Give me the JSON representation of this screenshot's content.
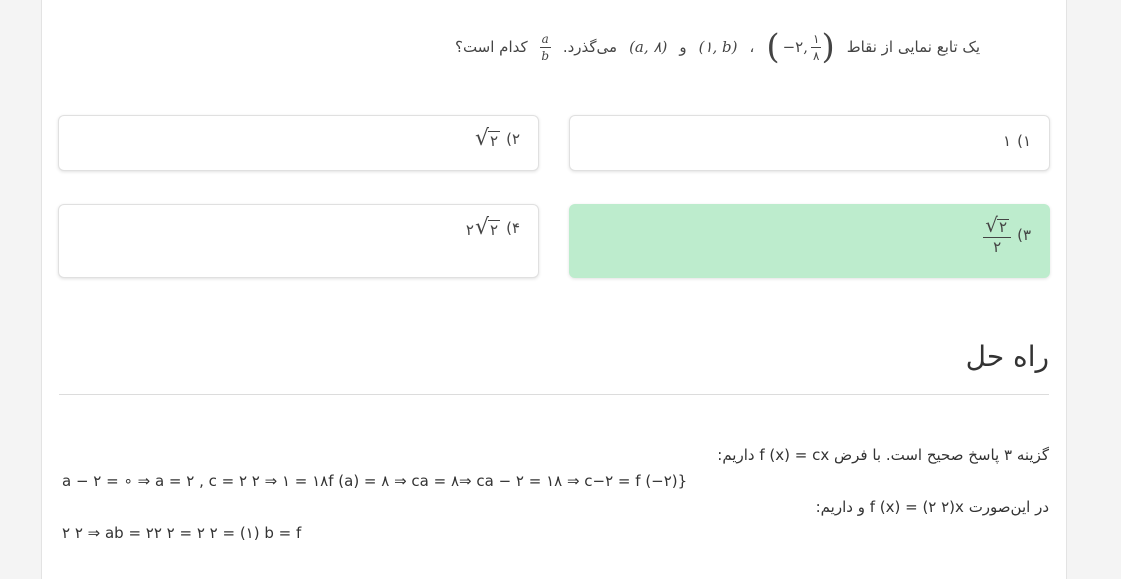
{
  "question": {
    "prefix": "یک تابع نمایی از نقاط",
    "point1": {
      "x": "−۲,",
      "num": "۱",
      "den": "۸"
    },
    "sep": "،",
    "point2": "(۱, b)",
    "and": "و",
    "point3": "(a, ۸)",
    "passes": "می‌گذرد.",
    "ratio": {
      "num": "a",
      "den": "b"
    },
    "suffix": "کدام است؟"
  },
  "options": [
    {
      "number": "۱)",
      "value": "۱",
      "correct": false
    },
    {
      "number": "۲)",
      "value": "۲",
      "correct": false
    },
    {
      "number": "۳)",
      "num": "۲",
      "den": "۲",
      "correct": true
    },
    {
      "number": "۴)",
      "coef": "۲",
      "value": "۲",
      "correct": false
    }
  ],
  "colors": {
    "correct_bg": "#bdeccd",
    "card_bg": "#ffffff",
    "page_bg": "#f4f4f4"
  },
  "solution": {
    "title": "راه حل",
    "line1": "گزینه ۳ پاسخ صحیح است. با فرض  f (x) = cx  داریم:",
    "line2": "a − ۲ = ∘ ⇒ a = ۲ , c = ۲ ۲ ⇒ ۱ = ۱۸f (a) = ۸ ⇒ ca = ۸⇒ ca − ۲ = ۱۸ ⇒ c−۲ = f (−۲)}",
    "line3": "در این‌صورت  f (x) = (۲ ۲)x  و داریم:",
    "line4": "۲ ۲ ⇒ ab = ۲۲ ۲ = ۲ ۲ = (۱) b = f"
  }
}
